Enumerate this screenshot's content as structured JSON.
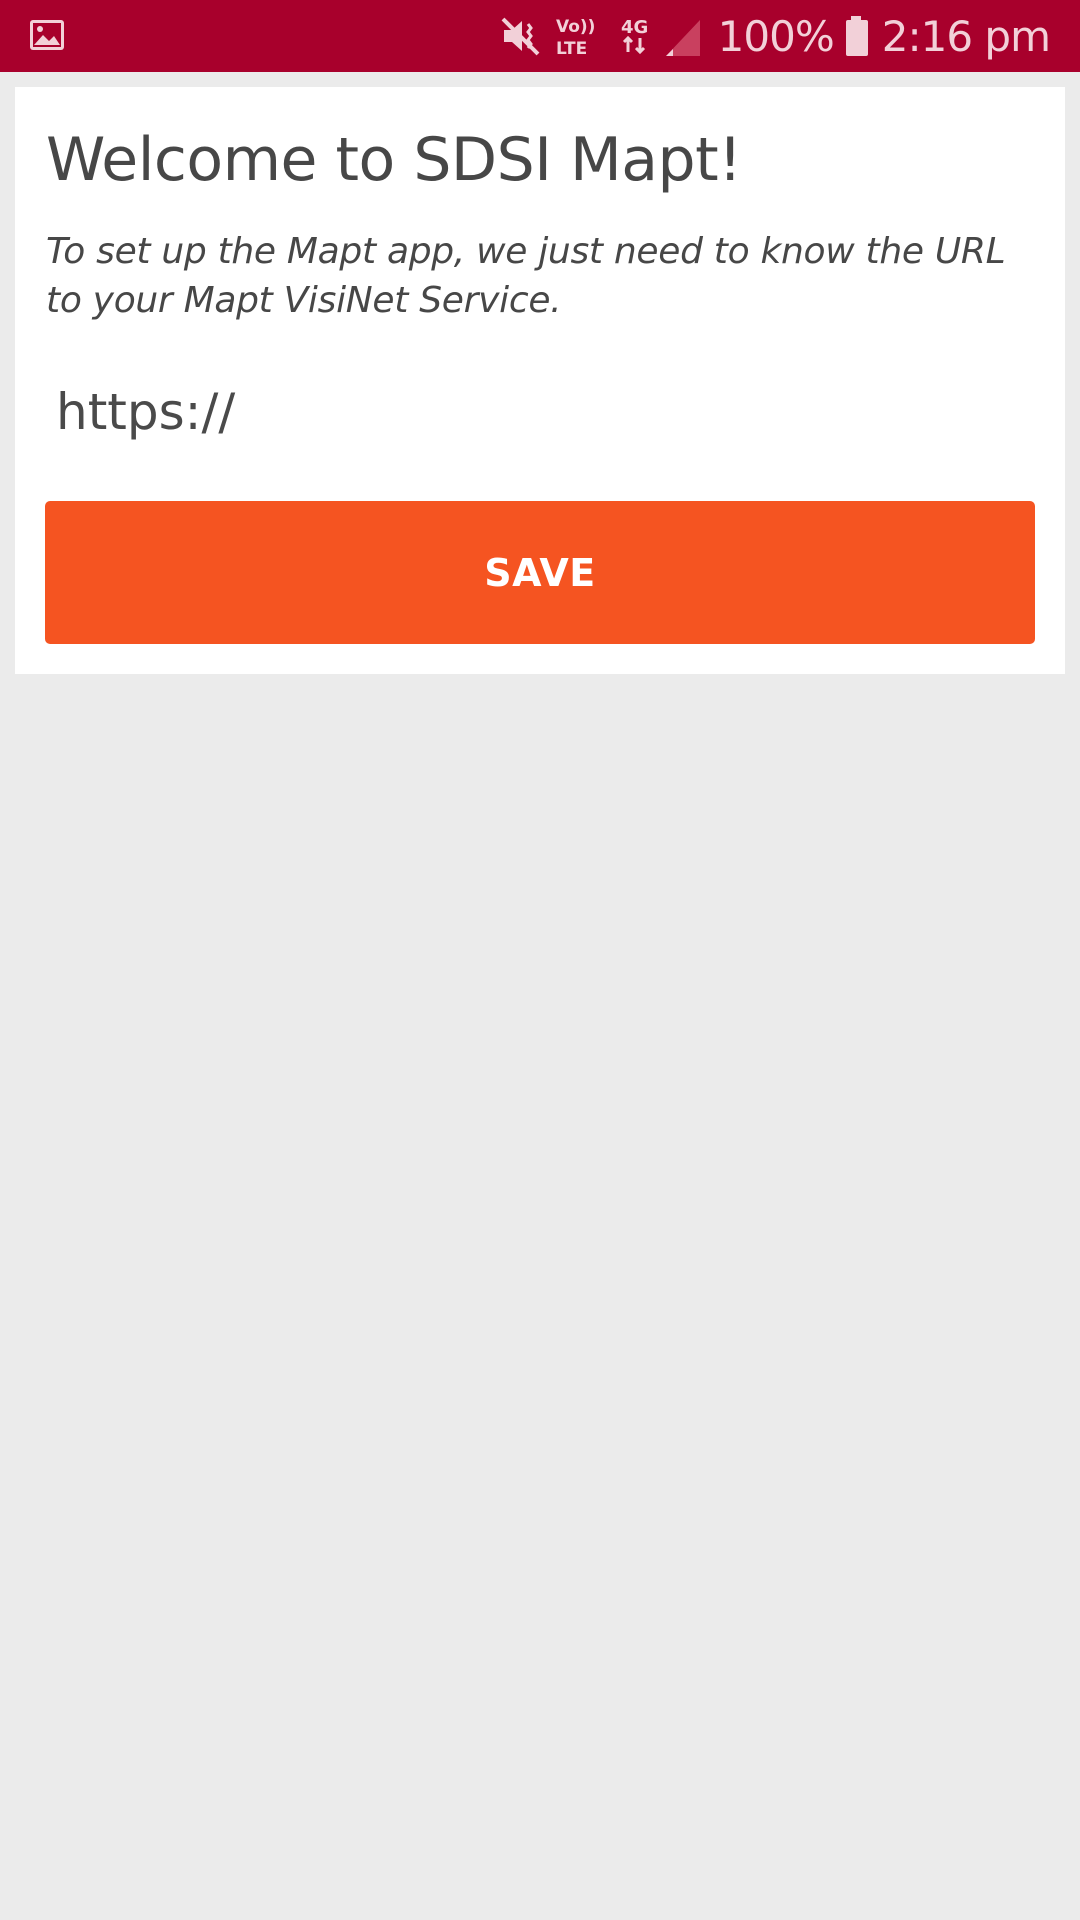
{
  "status_bar": {
    "left_icon": "image-notification-icon",
    "icons": [
      "mute-icon",
      "volte-icon",
      "4g-data-icon",
      "signal-icon"
    ],
    "volte_label_top": "Vo))",
    "volte_label_bottom": "LTE",
    "network_label": "4G",
    "battery_percent": "100%",
    "battery_icon": "battery-icon",
    "time": "2:16 pm",
    "background_color": "#a8002c"
  },
  "setup": {
    "title": "Welcome to SDSI Mapt!",
    "description": "To set up the Mapt app, we just need to know the URL to your Mapt VisiNet Service.",
    "url_value": "https://",
    "save_label": "SAVE",
    "button_color": "#f55421"
  }
}
